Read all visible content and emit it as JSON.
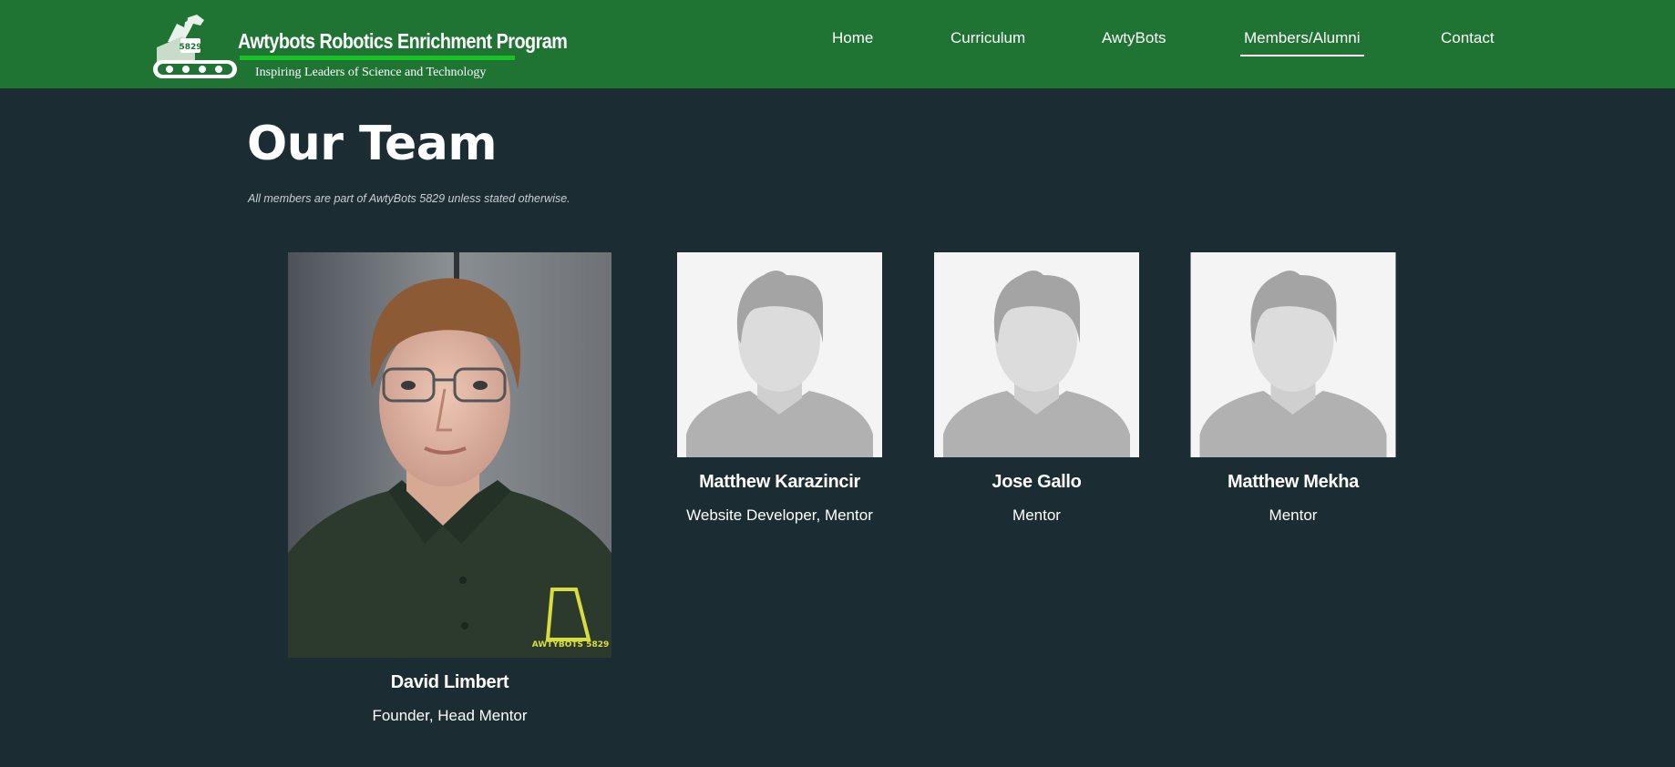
{
  "header": {
    "logo_title": "Awtybots Robotics Enrichment Program",
    "logo_tagline": "Inspiring Leaders of Science and Technology",
    "logo_badge": "5829",
    "colors": {
      "background": "#1f7333",
      "rule": "#17c224"
    }
  },
  "nav": {
    "items": [
      {
        "label": "Home"
      },
      {
        "label": "Curriculum"
      },
      {
        "label": "AwtyBots"
      },
      {
        "label": "Members/Alumni",
        "active": true
      },
      {
        "label": "Contact"
      }
    ]
  },
  "main": {
    "title": "Our Team",
    "note": "All members are part of AwtyBots 5829 unless stated otherwise.",
    "members": [
      {
        "name": "David Limbert",
        "role": "Founder, Head Mentor",
        "photo": "person-photo",
        "shirt_logo": "AWTYBOTS 5829"
      },
      {
        "name": "Matthew Karazincir",
        "role": "Website Developer, Mentor",
        "photo": "avatar-placeholder-icon"
      },
      {
        "name": "Jose Gallo",
        "role": "Mentor",
        "photo": "avatar-placeholder-icon"
      },
      {
        "name": "Matthew Mekha",
        "role": "Mentor",
        "photo": "avatar-placeholder-icon"
      }
    ]
  },
  "colors": {
    "page_background": "#1b2d33",
    "placeholder_background": "#f4f4f4"
  }
}
